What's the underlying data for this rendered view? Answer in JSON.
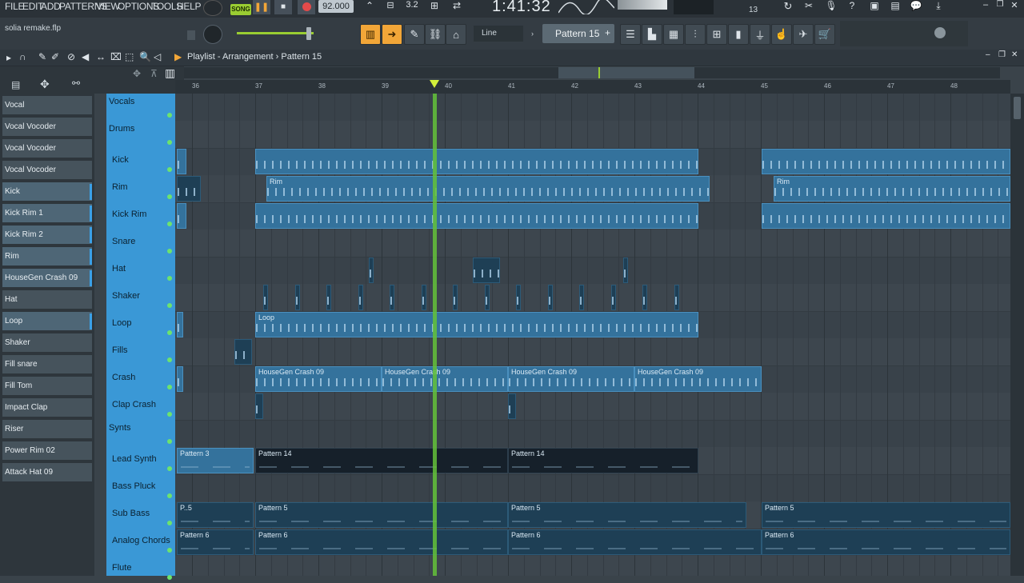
{
  "menu": [
    "FILE",
    "EDIT",
    "ADD",
    "PATTERNS",
    "VIEW",
    "OPTIONS",
    "TOOLS",
    "HELP"
  ],
  "transport": {
    "mode": "SONG",
    "tempo": "92.000",
    "time": "1:41:32",
    "cpu": "13"
  },
  "project": {
    "filename": "solia remake.flp"
  },
  "snap": {
    "value": "Line"
  },
  "pattern_selector": {
    "label": "Pattern 15",
    "add": "+"
  },
  "playlist": {
    "title": "Playlist - Arrangement",
    "separator": "›",
    "pattern": "Pattern 15"
  },
  "ruler": [
    "36",
    "37",
    "38",
    "39",
    "40",
    "41",
    "42",
    "43",
    "44",
    "45",
    "46",
    "47",
    "48"
  ],
  "browser": [
    {
      "label": "Vocal",
      "sel": false
    },
    {
      "label": "Vocal Vocoder",
      "sel": false
    },
    {
      "label": "Vocal Vocoder",
      "sel": false
    },
    {
      "label": "Vocal Vocoder",
      "sel": false
    },
    {
      "label": "Kick",
      "sel": true
    },
    {
      "label": "Kick Rim 1",
      "sel": true
    },
    {
      "label": "Kick Rim 2",
      "sel": true
    },
    {
      "label": "Rim",
      "sel": true
    },
    {
      "label": "HouseGen Crash 09",
      "sel": true
    },
    {
      "label": "Hat",
      "sel": false
    },
    {
      "label": "Loop",
      "sel": true
    },
    {
      "label": "Shaker",
      "sel": false
    },
    {
      "label": "Fill snare",
      "sel": false
    },
    {
      "label": "Fill Tom",
      "sel": false
    },
    {
      "label": "Impact Clap",
      "sel": false
    },
    {
      "label": "Riser",
      "sel": false
    },
    {
      "label": "Power Rim 02",
      "sel": false
    },
    {
      "label": "Attack Hat 09",
      "sel": false
    }
  ],
  "tracks": [
    {
      "label": "Vocals",
      "group": true
    },
    {
      "label": "Drums",
      "group": true
    },
    {
      "label": "Kick",
      "group": false
    },
    {
      "label": "Rim",
      "group": false
    },
    {
      "label": "Kick  Rim",
      "group": false
    },
    {
      "label": "Snare",
      "group": false
    },
    {
      "label": "Hat",
      "group": false
    },
    {
      "label": "Shaker",
      "group": false
    },
    {
      "label": "Loop",
      "group": false
    },
    {
      "label": "Fills",
      "group": false
    },
    {
      "label": "Crash",
      "group": false
    },
    {
      "label": "Clap Crash",
      "group": false
    },
    {
      "label": "Synts",
      "group": true
    },
    {
      "label": "Lead Synth",
      "group": false
    },
    {
      "label": "Bass Pluck",
      "group": false
    },
    {
      "label": "Sub Bass",
      "group": false
    },
    {
      "label": "Analog Chords",
      "group": false
    },
    {
      "label": "Flute",
      "group": false
    }
  ],
  "clip_labels": {
    "rim": "Rim",
    "loop": "Loop",
    "crash": "HouseGen Crash 09",
    "p3": "Pattern 3",
    "p14": "Pattern 14",
    "p5": "Pattern 5",
    "p6": "Pattern 6",
    "p5short": "P..5"
  },
  "colors": {
    "accent": "#f2a638",
    "track": "#3a98d6",
    "playhead": "#64c23a",
    "clip": "#34729c"
  }
}
